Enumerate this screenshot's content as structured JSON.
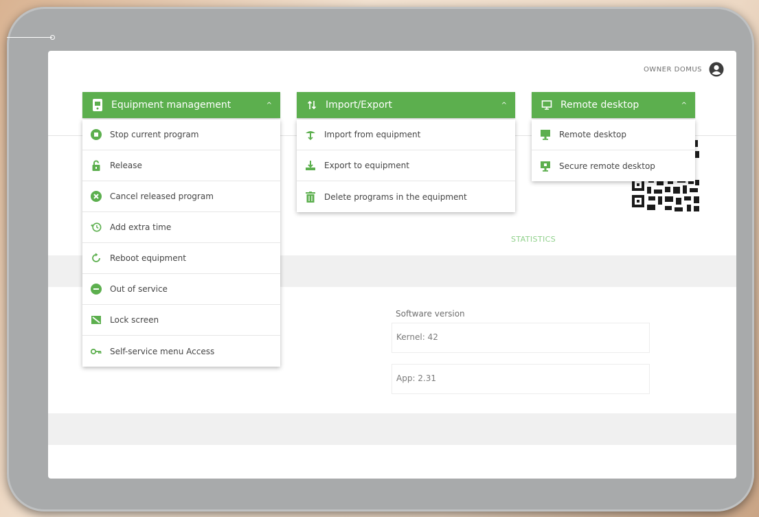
{
  "owner": {
    "name": "OWNER DOMUS",
    "icon": "user-circle-icon"
  },
  "colors": {
    "accent": "#5caf4e",
    "tab_active": "#8fd08a",
    "frame": "#a8aaab"
  },
  "menus": {
    "equipment": {
      "title": "Equipment management",
      "icon": "tablet-icon",
      "chevron": "^",
      "items": [
        {
          "label": "Stop current program",
          "icon": "stop-circle-icon"
        },
        {
          "label": "Release",
          "icon": "lock-open-icon"
        },
        {
          "label": "Cancel released program",
          "icon": "cancel-circle-icon"
        },
        {
          "label": "Add extra time",
          "icon": "clock-plus-icon"
        },
        {
          "label": "Reboot equipment",
          "icon": "reboot-icon"
        },
        {
          "label": "Out of service",
          "icon": "minus-circle-icon"
        },
        {
          "label": "Lock screen",
          "icon": "lock-screen-icon"
        },
        {
          "label": "Self-service menu Access",
          "icon": "key-icon"
        }
      ]
    },
    "import_export": {
      "title": "Import/Export",
      "icon": "import-export-icon",
      "chevron": "^",
      "items": [
        {
          "label": "Import from equipment",
          "icon": "import-icon"
        },
        {
          "label": "Export to equipment",
          "icon": "export-icon"
        },
        {
          "label": "Delete programs in the equipment",
          "icon": "trash-icon"
        }
      ]
    },
    "remote": {
      "title": "Remote desktop",
      "icon": "monitor-icon",
      "chevron": "^",
      "items": [
        {
          "label": "Remote desktop",
          "icon": "remote-desktop-icon"
        },
        {
          "label": "Secure remote desktop",
          "icon": "secure-remote-desktop-icon"
        }
      ]
    }
  },
  "tabs": {
    "statistics": "STATISTICS"
  },
  "software": {
    "label": "Software version",
    "kernel": "Kernel: 42",
    "app": "App: 2.31"
  }
}
